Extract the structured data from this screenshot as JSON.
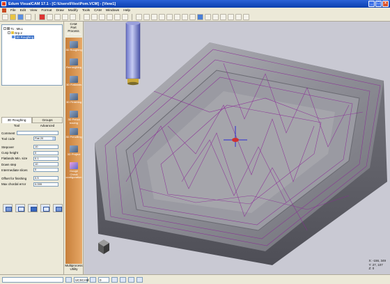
{
  "window": {
    "title": "Edum VisualCAM 17.1 - [C:\\Users\\Files\\Pom.VCM] - [View1]"
  },
  "menu": [
    "File",
    "Edit",
    "View",
    "Format",
    "Draw",
    "Modify",
    "Tools",
    "CAM",
    "Windows",
    "Help"
  ],
  "tree": {
    "items": [
      {
        "label": "T1 : MILL",
        "indent": 0
      },
      {
        "label": "Grp 2",
        "indent": 1
      },
      {
        "label": "3D Roughing",
        "indent": 2,
        "selected": true
      }
    ]
  },
  "tabs": {
    "left": "3D Roughing",
    "right": "Groups",
    "sub_left": "Tool",
    "sub_right": "Advanced"
  },
  "form": {
    "comment_label": "Comment",
    "comment_value": "",
    "tool_code_label": "Tool code",
    "tool_code_value": "Flat 20",
    "stepover_label": "Stepover",
    "stepover_value": "10",
    "cusp_label": "Cusp height",
    "cusp_value": "0",
    "flatlands_label": "Flatlands Min. size",
    "flatlands_value": "0.1",
    "downstep_label": "Down step",
    "downstep_value": "10",
    "intermediate_label": "Intermediate slices",
    "intermediate_value": "0",
    "offset_label": "Offset for finishing",
    "offset_value": "0.5",
    "chordal_label": "Max chordal error",
    "chordal_value": "0.099"
  },
  "cam": {
    "header_line1": "CAM",
    "header_line2": "Part",
    "header_line3": "Process",
    "tiles": [
      "3D Process",
      "3D Roughing",
      "Rerroughing",
      "3D Flatlands",
      "3D Finishing",
      "3D Pencil tracing",
      "3D Pencilling",
      "3D Project",
      "Gouge Check configuration"
    ],
    "footer_line1": "Multiprocess",
    "footer_line2": "Utility"
  },
  "status": {
    "ucs": "UCSCAM",
    "value": "0",
    "coords": {
      "x": "X: -156, 349",
      "y": "Y: 27, 107",
      "z": "Z: 0"
    }
  }
}
